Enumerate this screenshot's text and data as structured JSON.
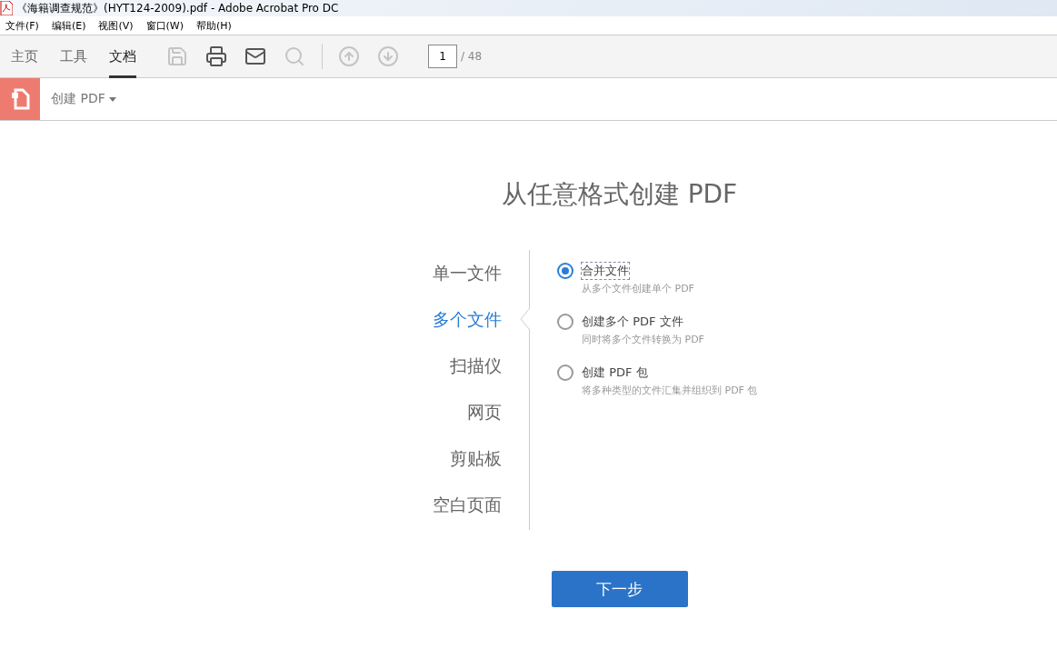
{
  "window": {
    "title": "《海籍调查规范》(HYT124-2009).pdf - Adobe Acrobat Pro DC"
  },
  "menu": [
    "文件(F)",
    "编辑(E)",
    "视图(V)",
    "窗口(W)",
    "帮助(H)"
  ],
  "tabs": [
    {
      "label": "主页",
      "selected": false
    },
    {
      "label": "工具",
      "selected": false
    },
    {
      "label": "文档",
      "selected": true
    }
  ],
  "toolbar": {
    "buttons": [
      {
        "kind": "save",
        "disabled": true
      },
      {
        "kind": "print",
        "disabled": false
      },
      {
        "kind": "mail",
        "disabled": false
      },
      {
        "kind": "search",
        "disabled": true
      }
    ],
    "nav": [
      {
        "kind": "up",
        "disabled": true
      },
      {
        "kind": "down",
        "disabled": true
      }
    ],
    "page": {
      "value": "1",
      "total": "/ 48"
    }
  },
  "tool_bar": {
    "label": "创建 PDF"
  },
  "heading": "从任意格式创建 PDF",
  "sources": [
    {
      "label": "单一文件",
      "selected": false
    },
    {
      "label": "多个文件",
      "selected": true
    },
    {
      "label": "扫描仪",
      "selected": false
    },
    {
      "label": "网页",
      "selected": false
    },
    {
      "label": "剪贴板",
      "selected": false
    },
    {
      "label": "空白页面",
      "selected": false
    }
  ],
  "options": [
    {
      "label": "合并文件",
      "description": "从多个文件创建单个 PDF",
      "selected": true
    },
    {
      "label": "创建多个 PDF 文件",
      "description": "同时将多个文件转换为 PDF",
      "selected": false
    },
    {
      "label": "创建 PDF 包",
      "description": "将多种类型的文件汇集并组织到 PDF 包",
      "selected": false
    }
  ],
  "next_button": "下一步"
}
